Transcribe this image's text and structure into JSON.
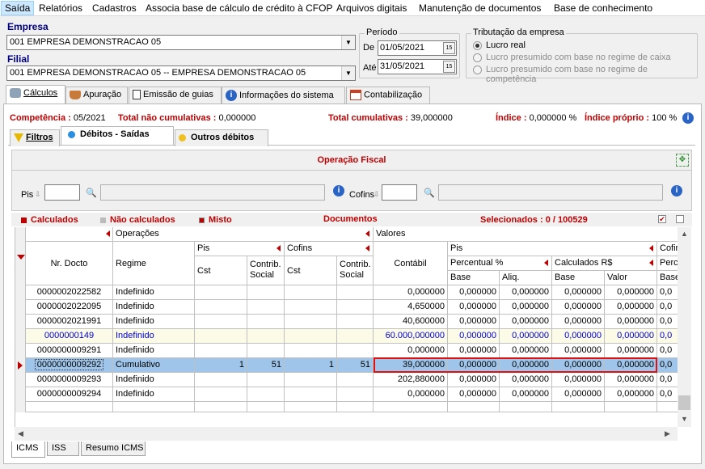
{
  "menu": [
    "Saída",
    "Relatórios",
    "Cadastros",
    "Associa base de cálculo de crédito à CFOP",
    "Arquivos digitais",
    "Manutenção de documentos",
    "Base de conhecimento"
  ],
  "empresa": {
    "label": "Empresa",
    "value": "001 EMPRESA DEMONSTRACAO 05"
  },
  "filial": {
    "label": "Filial",
    "value": "001 EMPRESA DEMONSTRACAO 05 -- EMPRESA DEMONSTRACAO 05"
  },
  "periodo": {
    "label": "Período",
    "de_label": "De",
    "de": "01/05/2021",
    "ate_label": "Até",
    "ate": "31/05/2021"
  },
  "tributacao": {
    "label": "Tributação da empresa",
    "options": [
      "Lucro real",
      "Lucro presumido com base no regime de caixa",
      "Lucro presumido com base no regime de competência"
    ],
    "selected": 0
  },
  "main_tabs": [
    "Cálculos",
    "Apuração",
    "Emissão de guias",
    "Informações do sistema",
    "Contabilização"
  ],
  "status": {
    "competencia_label": "Competência :",
    "competencia": "05/2021",
    "total_nc_label": "Total não cumulativas :",
    "total_nc": "0,000000",
    "total_c_label": "Total cumulativas :",
    "total_c": "39,000000",
    "indice_label": "Índice :",
    "indice": "0,000000 %",
    "indice_proprio_label": "Índice próprio :",
    "indice_proprio": "100 %"
  },
  "sub_tabs": [
    "Filtros",
    "Débitos - Saídas",
    "Outros débitos"
  ],
  "operacao": {
    "title": "Operação Fiscal",
    "pis_label": "Pis",
    "cofins_label": "Cofins"
  },
  "legend": {
    "calculados": "Calculados",
    "nao_calculados": "Não calculados",
    "misto": "Misto",
    "documentos": "Documentos",
    "selecionados": "Selecionados : 0 / 100529"
  },
  "grid_headers": {
    "operacoes": "Operações",
    "valores": "Valores",
    "nr_docto": "Nr. Docto",
    "regime": "Regime",
    "pis": "Pis",
    "cofins": "Cofins",
    "cst": "Cst",
    "contrib_social": "Contrib. Social",
    "contabil": "Contábil",
    "pis2": "Pis",
    "cofins_trunc": "Cofir",
    "percentual": "Percentual %",
    "calculados_rs": "Calculados R$",
    "perc_trunc": "Perc",
    "base": "Base",
    "aliq": "Aliq.",
    "valor": "Valor",
    "base_trunc": "Base"
  },
  "rows": [
    {
      "doc": "0000002022582",
      "regime": "Indefinido",
      "pis_cst": "",
      "pis_cs": "",
      "cof_cst": "",
      "cof_cs": "",
      "contabil": "0,000000",
      "b1": "0,000000",
      "a1": "0,000000",
      "b2": "0,000000",
      "v2": "0,000000",
      "b3": "0,0"
    },
    {
      "doc": "0000002022095",
      "regime": "Indefinido",
      "pis_cst": "",
      "pis_cs": "",
      "cof_cst": "",
      "cof_cs": "",
      "contabil": "4,650000",
      "b1": "0,000000",
      "a1": "0,000000",
      "b2": "0,000000",
      "v2": "0,000000",
      "b3": "0,0"
    },
    {
      "doc": "0000002021991",
      "regime": "Indefinido",
      "pis_cst": "",
      "pis_cs": "",
      "cof_cst": "",
      "cof_cs": "",
      "contabil": "40,600000",
      "b1": "0,000000",
      "a1": "0,000000",
      "b2": "0,000000",
      "v2": "0,000000",
      "b3": "0,0"
    },
    {
      "doc": "0000000149",
      "regime": "Indefinido",
      "pis_cst": "",
      "pis_cs": "",
      "cof_cst": "",
      "cof_cs": "",
      "contabil": "60.000,000000",
      "b1": "0,000000",
      "a1": "0,000000",
      "b2": "0,000000",
      "v2": "0,000000",
      "b3": "0,0"
    },
    {
      "doc": "0000000009291",
      "regime": "Indefinido",
      "pis_cst": "",
      "pis_cs": "",
      "cof_cst": "",
      "cof_cs": "",
      "contabil": "0,000000",
      "b1": "0,000000",
      "a1": "0,000000",
      "b2": "0,000000",
      "v2": "0,000000",
      "b3": "0,0"
    },
    {
      "doc": "0000000009292",
      "regime": "Cumulativo",
      "pis_cst": "1",
      "pis_cs": "51",
      "cof_cst": "1",
      "cof_cs": "51",
      "contabil": "39,000000",
      "b1": "0,000000",
      "a1": "0,000000",
      "b2": "0,000000",
      "v2": "0,000000",
      "b3": "0,0"
    },
    {
      "doc": "0000000009293",
      "regime": "Indefinido",
      "pis_cst": "",
      "pis_cs": "",
      "cof_cst": "",
      "cof_cs": "",
      "contabil": "202,880000",
      "b1": "0,000000",
      "a1": "0,000000",
      "b2": "0,000000",
      "v2": "0,000000",
      "b3": "0,0"
    },
    {
      "doc": "0000000009294",
      "regime": "Indefinido",
      "pis_cst": "",
      "pis_cs": "",
      "cof_cst": "",
      "cof_cs": "",
      "contabil": "0,000000",
      "b1": "0,000000",
      "a1": "0,000000",
      "b2": "0,000000",
      "v2": "0,000000",
      "b3": "0,0"
    }
  ],
  "bottom_tabs": [
    "ICMS",
    "ISS",
    "Resumo ICMS"
  ],
  "colors": {
    "accent_red": "#c00000",
    "navy": "#000080",
    "selected_row": "#9fc6ea",
    "blue_row_text": "#0000cc"
  }
}
